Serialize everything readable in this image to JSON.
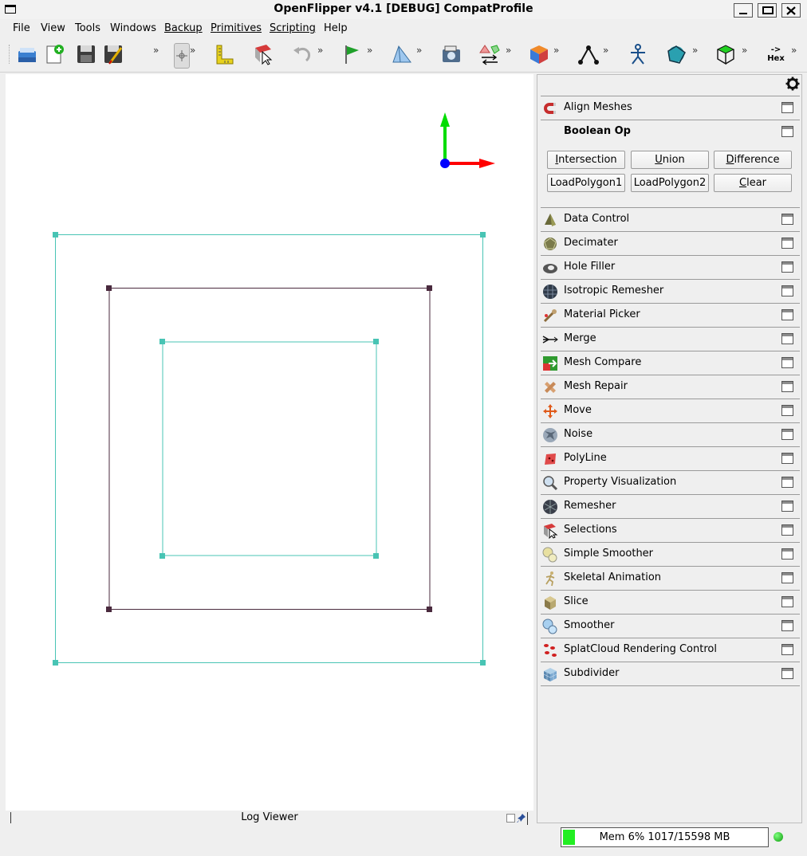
{
  "window": {
    "title": "OpenFlipper v4.1 [DEBUG] CompatProfile"
  },
  "menu": [
    {
      "label": "File",
      "u": false
    },
    {
      "label": "View",
      "u": false
    },
    {
      "label": "Tools",
      "u": false
    },
    {
      "label": "Windows",
      "u": false
    },
    {
      "label": "Backup",
      "u": true
    },
    {
      "label": "Primitives",
      "u": true
    },
    {
      "label": "Scripting",
      "u": true
    },
    {
      "label": "Help",
      "u": false
    }
  ],
  "toolbar": {
    "chevron": "»",
    "hex_label_top": "->",
    "hex_label_bottom": "Hex"
  },
  "boolean_op": {
    "title": "Boolean Op",
    "buttons": [
      "Intersection",
      "Union",
      "Difference",
      "LoadPolygon1",
      "LoadPolygon2",
      "Clear"
    ]
  },
  "toolbox": {
    "first": "Align Meshes",
    "items": [
      "Data Control",
      "Decimater",
      "Hole Filler",
      "Isotropic Remesher",
      "Material Picker",
      "Merge",
      "Mesh Compare",
      "Mesh Repair",
      "Move",
      "Noise",
      "PolyLine",
      "Property Visualization",
      "Remesher",
      "Selections",
      "Simple Smoother",
      "Skeletal Animation",
      "Slice",
      "Smoother",
      "SplatCloud Rendering Control",
      "Subdivider"
    ]
  },
  "log_viewer": {
    "title": "Log Viewer"
  },
  "status": {
    "memory": "Mem 6% 1017/15598 MB",
    "memory_fraction": 0.06
  },
  "colors": {
    "outer_square": "#48c4b4",
    "middle_square": "#4a2a3e",
    "inner_square": "#48c4b4",
    "x_axis": "#ff0000",
    "y_axis": "#00dd00",
    "origin": "#0000ff"
  }
}
